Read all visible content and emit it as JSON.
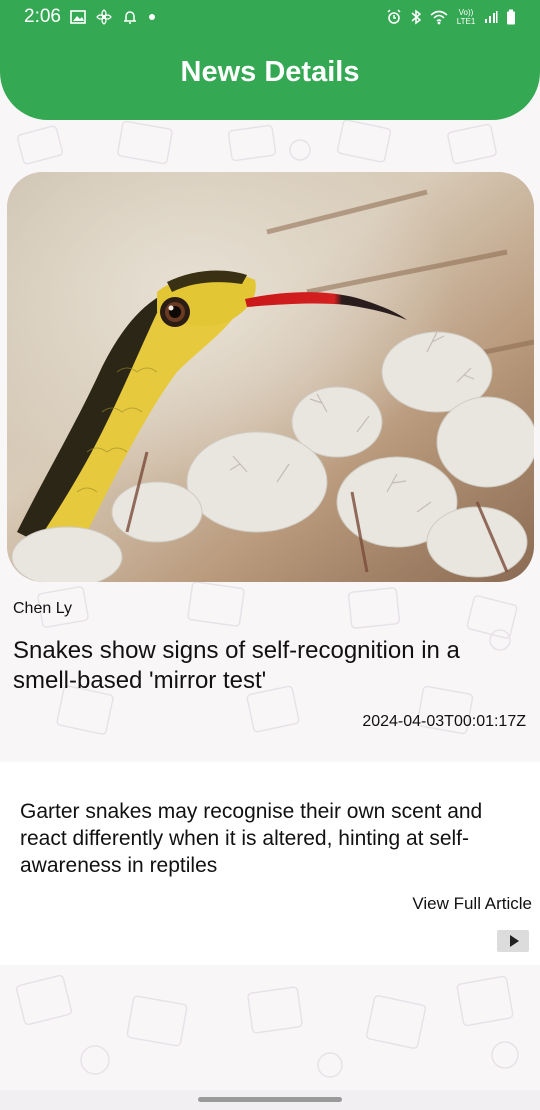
{
  "status_bar": {
    "time": "2:06",
    "left_icons": [
      "image-icon",
      "pinwheel-icon",
      "bell-icon",
      "dot-icon"
    ],
    "right_icons": [
      "alarm-icon",
      "bluetooth-icon",
      "wifi-icon",
      "volte-icon",
      "signal-icon",
      "battery-icon"
    ],
    "volte_label": "Vo)) LTE1"
  },
  "app_bar": {
    "title": "News Details",
    "color": "#34a853"
  },
  "article": {
    "image_icon": "snake-photo",
    "author": "Chen Ly",
    "headline": "Snakes show signs of self-recognition in a smell-based 'mirror test'",
    "published": "2024-04-03T00:01:17Z",
    "description": "Garter snakes may recognise their own scent and react differently when it is altered, hinting at self-awareness in reptiles",
    "view_full_label": "View Full Article",
    "play_icon": "play-icon"
  }
}
